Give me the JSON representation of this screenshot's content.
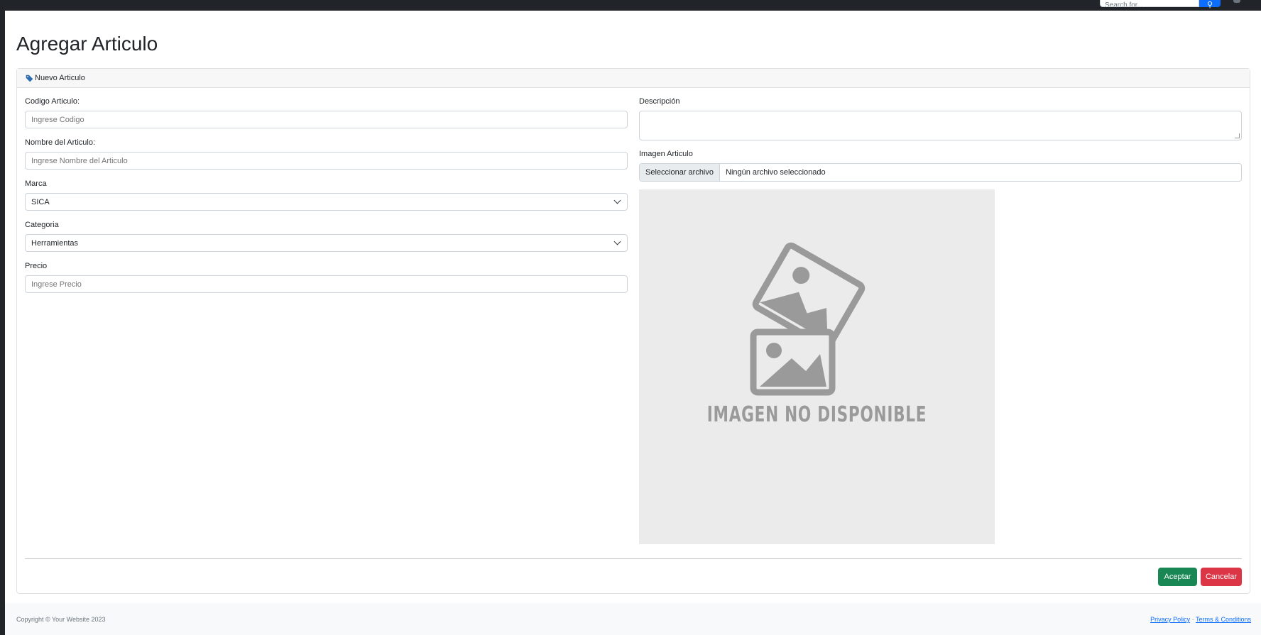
{
  "navbar": {
    "search_placeholder": "Search for...",
    "search_icon": "search-icon",
    "user_icon": "user-icon"
  },
  "page": {
    "title": "Agregar Articulo"
  },
  "card": {
    "header_icon": "tag-icon",
    "header": "Nuevo Articulo"
  },
  "form": {
    "codigo": {
      "label": "Codigo Articulo:",
      "placeholder": "Ingrese Codigo"
    },
    "nombre": {
      "label": "Nombre del Articulo:",
      "placeholder": "Ingrese Nombre del Articulo"
    },
    "marca": {
      "label": "Marca",
      "value": "SICA"
    },
    "categoria": {
      "label": "Categoria",
      "value": "Herramientas"
    },
    "precio": {
      "label": "Precio",
      "placeholder": "Ingrese Precio"
    },
    "descripcion": {
      "label": "Descripción"
    },
    "imagen": {
      "label": "Imagen Articulo",
      "button": "Seleccionar archivo",
      "status": "Ningún archivo seleccionado",
      "preview_text": "IMAGEN NO DISPONIBLE"
    }
  },
  "actions": {
    "accept": "Aceptar",
    "cancel": "Cancelar"
  },
  "footer": {
    "copyright": "Copyright © Your Website 2023",
    "privacy": "Privacy Policy",
    "separator": "·",
    "terms": "Terms & Conditions"
  },
  "colors": {
    "accept": "#198754",
    "cancel": "#dc3545",
    "primary": "#0d6efd",
    "navbar": "#212529"
  }
}
